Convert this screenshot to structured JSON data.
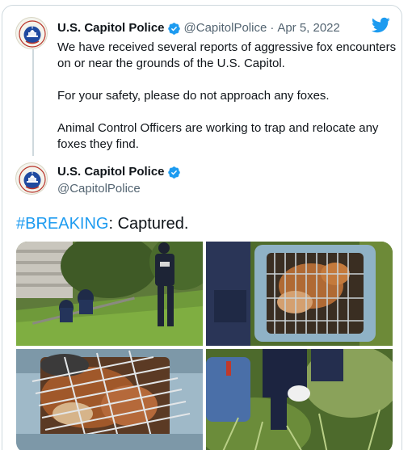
{
  "tweet1": {
    "display_name": "U.S. Capitol Police",
    "handle": "@CapitolPolice",
    "separator": "·",
    "date": "Apr 5, 2022",
    "paragraphs": [
      "We have received several reports of aggressive fox encounters on or near the grounds of the U.S. Capitol.",
      "For your safety, please do not approach any foxes.",
      "Animal Control Officers are working to trap and relocate any foxes they find."
    ]
  },
  "tweet2": {
    "display_name": "U.S. Capitol Police",
    "handle": "@CapitolPolice",
    "hashtag": "#BREAKING",
    "text_rest": ": Captured.",
    "media": [
      {
        "name": "officers-searching-grass-photo"
      },
      {
        "name": "fox-in-carrier-photo"
      },
      {
        "name": "fox-behind-cage-bars-photo"
      },
      {
        "name": "officers-kneeling-bushes-photo"
      }
    ]
  },
  "icons": {
    "verified": "verified-badge-icon",
    "brand": "twitter-bird-icon",
    "avatar": "capitol-police-badge-logo"
  },
  "colors": {
    "accent": "#1d9bf0",
    "text": "#0f1419",
    "secondary": "#536471",
    "border": "#cfd9de"
  }
}
